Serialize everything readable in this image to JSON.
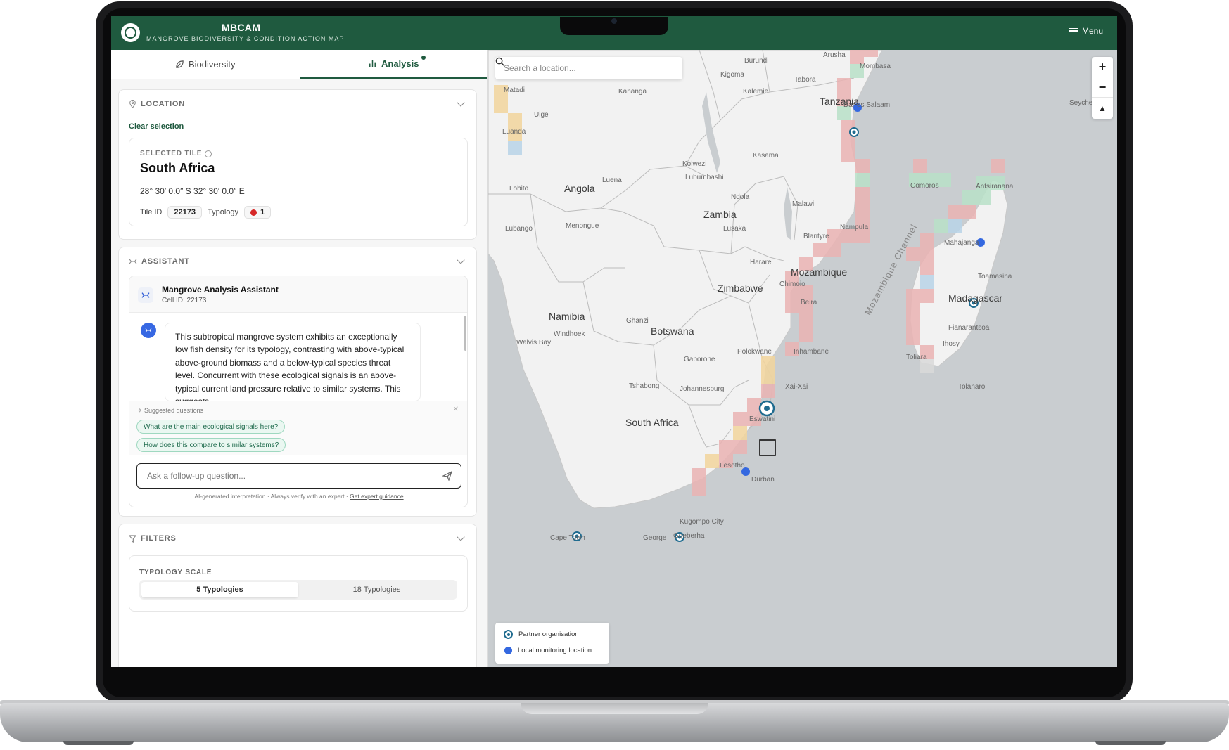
{
  "header": {
    "title": "MBCAM",
    "subtitle": "MANGROVE BIODIVERSITY & CONDITION ACTION MAP",
    "menu_label": "Menu"
  },
  "tabs": [
    {
      "label": "Biodiversity",
      "icon": "leaf-icon",
      "active": false
    },
    {
      "label": "Analysis",
      "icon": "bar-chart-icon",
      "active": true
    }
  ],
  "location": {
    "heading": "LOCATION",
    "clear_label": "Clear selection",
    "tile_label": "SELECTED TILE",
    "country": "South Africa",
    "coords": "28° 30′ 0.0″ S 32° 30′ 0.0″ E",
    "tile_id_label": "Tile ID",
    "tile_id": "22173",
    "typology_label": "Typology",
    "typology_value": "1",
    "typology_color": "#d62828"
  },
  "assistant": {
    "heading": "ASSISTANT",
    "name": "Mangrove Analysis Assistant",
    "cell_id": "Cell ID: 22173",
    "message": "This subtropical mangrove system exhibits an exceptionally low fish density for its typology, contrasting with above-typical above-ground biomass and a below-typical species threat level. Concurrent with these ecological signals is an above-typical current land pressure relative to similar systems. This suggests",
    "suggested_label": "Suggested questions",
    "suggestions": [
      "What are the main ecological signals here?",
      "How does this compare to similar systems?"
    ],
    "input_placeholder": "Ask a follow-up question...",
    "disclaimer": "AI-generated interpretation · Always verify with an expert · ",
    "disclaimer_link": "Get expert guidance"
  },
  "filters": {
    "heading": "FILTERS",
    "typology_scale_label": "TYPOLOGY SCALE",
    "options": [
      "5 Typologies",
      "18 Typologies"
    ],
    "selected": "5 Typologies"
  },
  "map": {
    "search_placeholder": "Search a location...",
    "zoom_in": "+",
    "zoom_out": "−",
    "compass": "▲",
    "country_labels": [
      "Tanzania",
      "Angola",
      "Zambia",
      "Malawi",
      "Mozambique",
      "Zimbabwe",
      "Namibia",
      "Botswana",
      "South Africa",
      "Lesotho",
      "Eswatini",
      "Madagascar",
      "Comoros",
      "Seyche"
    ],
    "city_labels": [
      "Burundi",
      "Arusha",
      "Mombasa",
      "Tabora",
      "Dar es Salaam",
      "Kigoma",
      "Kananga",
      "Matadi",
      "Uige",
      "Luanda",
      "Kalemie",
      "Kolwezi",
      "Lubumbashi",
      "Kasama",
      "Luena",
      "Lobito",
      "Lubango",
      "Menongue",
      "Ndola",
      "Lusaka",
      "Nampula",
      "Blantyre",
      "Harare",
      "Chimoio",
      "Beira",
      "Windhoek",
      "Walvis Bay",
      "Ghanzi",
      "Inhambane",
      "Polokwane",
      "Gaborone",
      "Xai-Xai",
      "Tshabong",
      "Johannesburg",
      "Durban",
      "Cape Town",
      "George",
      "Gqeberha",
      "Antsiranana",
      "Mahajanga",
      "Toamasina",
      "Fianarantsoa",
      "Ihosy",
      "Toliara",
      "Tolanaro",
      "Kugompo City",
      "Mozambique Channel"
    ],
    "legend": [
      {
        "label": "Partner organisation",
        "icon": "partner-marker-icon"
      },
      {
        "label": "Local monitoring location",
        "icon": "local-marker-icon",
        "color": "#3468e0"
      }
    ]
  }
}
